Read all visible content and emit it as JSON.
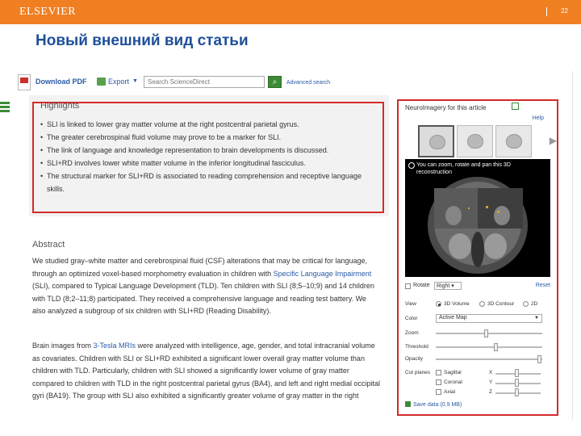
{
  "header": {
    "brand": "ELSEVIER",
    "page_number": "22"
  },
  "slide": {
    "title": "Новый внешний вид статьи"
  },
  "toolbar": {
    "download_pdf": "Download PDF",
    "export_label": "Export",
    "search_placeholder": "Search ScienceDirect",
    "advanced_search": "Advanced search"
  },
  "highlights": {
    "heading": "Highlights",
    "items": [
      {
        "text": "SLI is linked to lower gray matter volume at the right postcentral parietal gyrus."
      },
      {
        "text": "The greater cerebrospinal fluid volume may prove to be a marker for SLI."
      },
      {
        "text": "The link of language and knowledge representation to brain developments is discussed."
      },
      {
        "text": "SLI+RD involves lower white matter volume in the inferior longitudinal fasciculus."
      },
      {
        "text": "The structural marker for SLI+RD is associated to reading comprehension and receptive language skills."
      }
    ]
  },
  "abstract": {
    "heading": "Abstract",
    "p1_a": "We studied gray–white matter and cerebrospinal fluid (CSF) alterations that may be critical for language, through an optimized voxel-based morphometry evaluation in children with ",
    "p1_link": "Specific Language Impairment",
    "p1_b": " (SLI), compared to Typical Language Development (TLD). Ten children with SLI (8;5–10;9) and 14 children with TLD (8;2–11;8) participated. They received a comprehensive language and reading test battery. We also analyzed a subgroup of six children with SLI+RD (Reading Disability).",
    "p2_a": "Brain images from ",
    "p2_link": "3-Tesla MRIs",
    "p2_b": " were analyzed with intelligence, age, gender, and total intracranial volume as covariates. Children with SLI or SLI+RD exhibited a significant lower overall gray matter volume than children with TLD. Particularly, children with SLI showed a significantly lower volume of gray matter compared to children with TLD in the right postcentral parietal gyrus (BA4), and left and right medial occipital gyri (BA19). The group with SLI also exhibited a significantly greater volume of gray matter in the right"
  },
  "neuro": {
    "heading": "NeuroImagery for this article",
    "help": "Help",
    "viewer_caption": "You can zoom, rotate and pan this 3D reconstruction",
    "rotate_label": "Rotate",
    "rotate_value": "Right",
    "reset": "Reset",
    "view_label": "View",
    "view_options": [
      "3D Volume",
      "3D Contour",
      "2D"
    ],
    "color_label": "Color",
    "color_value": "Active Map",
    "zoom_label": "Zoom",
    "threshold_label": "Threshold",
    "opacity_label": "Opacity",
    "cut_planes_label": "Cut planes",
    "cut_planes": [
      {
        "name": "Sagittal",
        "axis": "X"
      },
      {
        "name": "Coronal",
        "axis": "Y"
      },
      {
        "name": "Axial",
        "axis": "Z"
      }
    ],
    "save_label": "Save data (0.9 MB)"
  },
  "colors": {
    "brand_orange": "#f07f22",
    "title_blue": "#1f4f9a",
    "highlight_red": "#d42a2a",
    "link_blue": "#2a5aa8"
  }
}
